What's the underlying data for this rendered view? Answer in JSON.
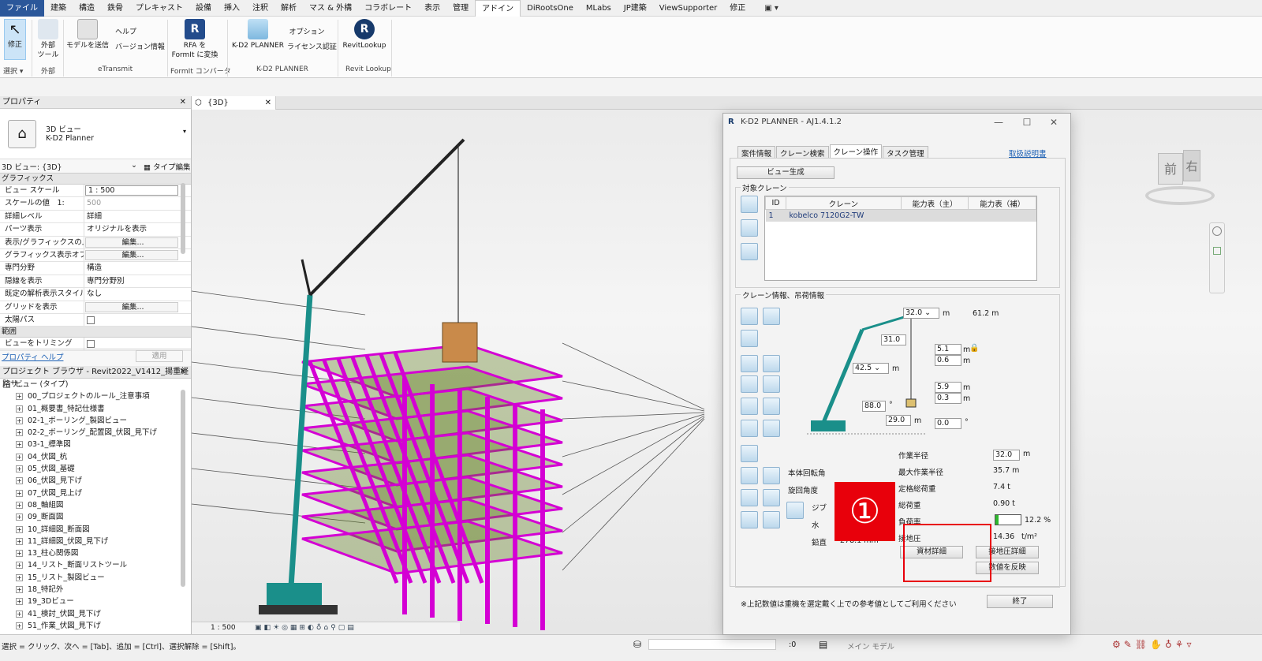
{
  "ribbon_tabs": [
    "ファイル",
    "建築",
    "構造",
    "鉄骨",
    "プレキャスト",
    "設備",
    "挿入",
    "注釈",
    "解析",
    "マス & 外構",
    "コラボレート",
    "表示",
    "管理",
    "アドイン",
    "DiRootsOne",
    "MLabs",
    "JP建築",
    "ViewSupporter",
    "修正"
  ],
  "ribbon": {
    "modify": "修正",
    "select_panel": "選択 ▾",
    "external_tools": "外部\nツール",
    "external_panel": "外部",
    "send_model": "モデルを送信",
    "help": "ヘルプ",
    "version": "バージョン情報",
    "etransmit_panel": "eTransmit",
    "rfa_line1": "RFA を",
    "rfa_line2": "FormIt に変換",
    "formit_panel": "FormIt コンバータ",
    "kd2": "K-D2 PLANNER",
    "option1": "オプション",
    "license": "ライセンス認証",
    "kd2_panel": "K-D2 PLANNER",
    "revitlookup": "RevitLookup",
    "revitlookup_panel": "Revit Lookup"
  },
  "properties": {
    "title": "プロパティ",
    "type_line1": "3D ビュー",
    "type_line2": "K-D2 Planner",
    "selector": "3D ビュー: {3D}",
    "type_edit": "タイプ編集",
    "group_graphics": "グラフィックス",
    "rows": [
      {
        "k": "ビュー スケール",
        "v": "1 : 500",
        "style": "box"
      },
      {
        "k": "スケールの値　1:",
        "v": "500",
        "style": "gray"
      },
      {
        "k": "詳細レベル",
        "v": "詳細",
        "style": ""
      },
      {
        "k": "パーツ表示",
        "v": "オリジナルを表示",
        "style": ""
      },
      {
        "k": "表示/グラフィックスの上...",
        "v": "編集...",
        "style": "btn"
      },
      {
        "k": "グラフィックス表示オプシ...",
        "v": "編集...",
        "style": "btn"
      },
      {
        "k": "専門分野",
        "v": "構造",
        "style": ""
      },
      {
        "k": "隠線を表示",
        "v": "専門分野別",
        "style": ""
      },
      {
        "k": "既定の解析表示スタイル",
        "v": "なし",
        "style": ""
      },
      {
        "k": "グリッドを表示",
        "v": "編集...",
        "style": "btn"
      },
      {
        "k": "太陽パス",
        "v": "",
        "style": "check"
      }
    ],
    "group_range": "範囲",
    "crop": "ビューをトリミング",
    "help_link": "プロパティ ヘルプ",
    "apply": "適用"
  },
  "browser": {
    "title": "プロジェクト ブラウザ - Revit2022_V1412_揚重経路サ...",
    "root": "ビュー (タイプ)",
    "items": [
      "00_プロジェクトのルール_注意事項",
      "01_概要書_特記仕様書",
      "02-1_ボーリング_製図ビュー",
      "02-2_ボーリング_配置図_伏図_見下げ",
      "03-1_標準図",
      "04_伏図_杭",
      "05_伏図_基礎",
      "06_伏図_見下げ",
      "07_伏図_見上げ",
      "08_軸組図",
      "09_断面図",
      "10_詳細図_断面図",
      "11_詳細図_伏図_見下げ",
      "13_柱心関係図",
      "14_リスト_断面リストツール",
      "15_リスト_製図ビュー",
      "18_特記外",
      "19_3Dビュー",
      "41_検討_伏図_見下げ",
      "51_作業_伏図_見下げ"
    ]
  },
  "view_tab": "{3D}",
  "viewcube": {
    "front": "前",
    "right": "右"
  },
  "view_scale": "1 : 500",
  "status_left": "選択 = クリック、次へ = [Tab]、追加 = [Ctrl]、選択解除 = [Shift]。",
  "status_zero": ":0",
  "status_model": "メイン モデル",
  "dialog": {
    "title": "K-D2 PLANNER - AJ1.4.1.2",
    "tabs": [
      "案件情報",
      "クレーン検索",
      "クレーン操作",
      "タスク管理"
    ],
    "manual_link": "取扱説明書",
    "view_gen": "ビュー生成",
    "target_crane": "対象クレーン",
    "table_headers": [
      "ID",
      "クレーン",
      "能力表（主）",
      "能力表（補）"
    ],
    "table_rows": [
      {
        "id": "1",
        "crane": "kobelco 7120G2-TW",
        "main": "",
        "aux": ""
      }
    ],
    "crane_info": "クレーン情報、吊荷情報",
    "fields": {
      "jib_angle": "32.0",
      "m1": "m",
      "total_height": "61.2 m",
      "v31": "31.0",
      "boom_angle": "42.5",
      "m2": "m",
      "v51": "5.1",
      "v06": "0.6",
      "v59": "5.9",
      "v03": "0.3",
      "v880": "88.0",
      "deg1": "°",
      "v290": "29.0",
      "m3": "m",
      "v00": "0.0",
      "deg2": "°",
      "m_u": "m",
      "m_u2": "m",
      "m_u3": "m",
      "m_u4": "m"
    },
    "body_rotation": "本体回転角",
    "swing_angle": "旋回角度",
    "jib": "ジブ",
    "horizontal": "水",
    "vertical": "鉛直",
    "vertical_value": "278.1 mm",
    "results": [
      {
        "k": "作業半径",
        "v": "32.0",
        "unit": "m",
        "box": true
      },
      {
        "k": "最大作業半径",
        "v": "35.7 m",
        "unit": "",
        "box": false
      },
      {
        "k": "定格総荷重",
        "v": "7.4 t",
        "unit": "",
        "box": false
      },
      {
        "k": "総荷重",
        "v": "0.90 t",
        "unit": "",
        "box": false
      },
      {
        "k": "負荷率",
        "v": "12.2 %",
        "unit": "",
        "box": false
      },
      {
        "k": "接地圧",
        "v": "14.36",
        "unit": "t/m²",
        "box": false
      }
    ],
    "load_ratio_fill": 0.122,
    "material_detail": "資材詳細",
    "ground_detail": "接地圧詳細",
    "reflect_values": "数値を反映",
    "note": "※上記数値は重機を選定戴く上での参考値としてご利用ください",
    "close_button": "終了"
  },
  "marker": "①",
  "colors": {
    "accent": "#2b579a",
    "beam": "#d400d4",
    "marker": "#e8000b",
    "crane": "#1a8f8a"
  }
}
